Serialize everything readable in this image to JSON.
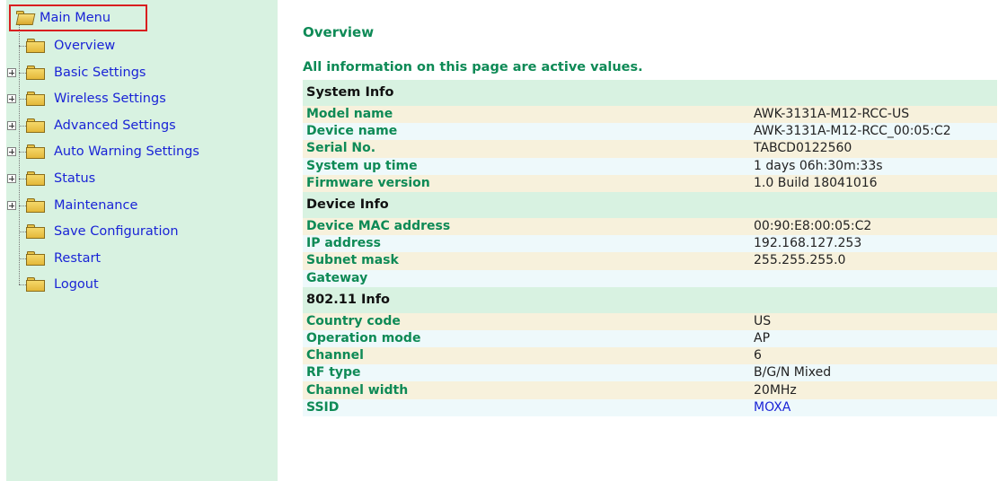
{
  "sidebar": {
    "root": "Main Menu",
    "items": [
      {
        "label": "Overview",
        "expandable": false
      },
      {
        "label": "Basic Settings",
        "expandable": true
      },
      {
        "label": "Wireless Settings",
        "expandable": true
      },
      {
        "label": "Advanced Settings",
        "expandable": true
      },
      {
        "label": "Auto Warning Settings",
        "expandable": true
      },
      {
        "label": "Status",
        "expandable": true
      },
      {
        "label": "Maintenance",
        "expandable": true
      },
      {
        "label": "Save Configuration",
        "expandable": false
      },
      {
        "label": "Restart",
        "expandable": false
      },
      {
        "label": "Logout",
        "expandable": false
      }
    ]
  },
  "main": {
    "title": "Overview",
    "note": "All information on this page are active values.",
    "sections": [
      {
        "title": "System Info",
        "rows": [
          {
            "key": "Model name",
            "value": "AWK-3131A-M12-RCC-US"
          },
          {
            "key": "Device name",
            "value": "AWK-3131A-M12-RCC_00:05:C2"
          },
          {
            "key": "Serial No.",
            "value": "TABCD0122560"
          },
          {
            "key": "System up time",
            "value": "1 days 06h:30m:33s"
          },
          {
            "key": "Firmware version",
            "value": "1.0 Build 18041016"
          }
        ]
      },
      {
        "title": "Device Info",
        "rows": [
          {
            "key": "Device MAC address",
            "value": "00:90:E8:00:05:C2"
          },
          {
            "key": "IP address",
            "value": "192.168.127.253"
          },
          {
            "key": "Subnet mask",
            "value": "255.255.255.0"
          },
          {
            "key": "Gateway",
            "value": ""
          }
        ]
      },
      {
        "title": "802.11 Info",
        "rows": [
          {
            "key": "Country code",
            "value": "US"
          },
          {
            "key": "Operation mode",
            "value": "AP"
          },
          {
            "key": "Channel",
            "value": "6"
          },
          {
            "key": "RF type",
            "value": "B/G/N Mixed"
          },
          {
            "key": "Channel width",
            "value": "20MHz"
          },
          {
            "key": "SSID",
            "value": "MOXA",
            "link": true
          }
        ]
      }
    ]
  },
  "colors": {
    "sidebar_bg": "#d8f2e1",
    "menu_link": "#1a24d6",
    "label_green": "#0e8a56",
    "highlight_border": "#d91f1f",
    "row_odd": "#f7f1dc",
    "row_even": "#eef9fb"
  },
  "icons": {
    "folder": "folder-icon",
    "folder_open": "open-folder-icon",
    "expand": "plus-box-icon"
  }
}
